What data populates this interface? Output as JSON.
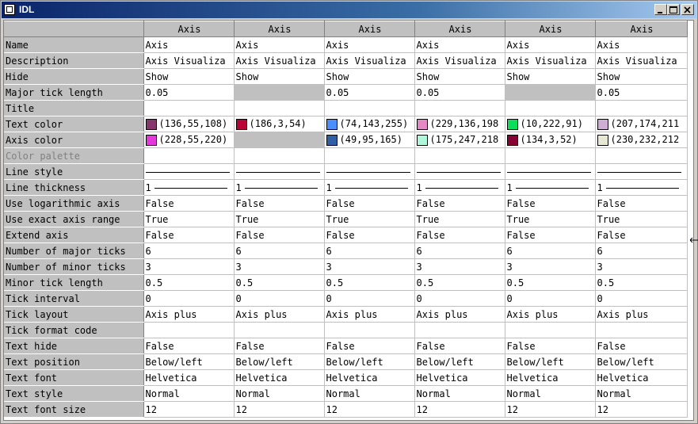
{
  "window": {
    "title": "IDL"
  },
  "columns": [
    "Axis",
    "Axis",
    "Axis",
    "Axis",
    "Axis",
    "Axis"
  ],
  "rows": [
    {
      "label": "Name",
      "values": [
        "Axis",
        "Axis",
        "Axis",
        "Axis",
        "Axis",
        "Axis"
      ]
    },
    {
      "label": "Description",
      "values": [
        "Axis Visualiza",
        "Axis Visualiza",
        "Axis Visualiza",
        "Axis Visualiza",
        "Axis Visualiza",
        "Axis Visualiza"
      ]
    },
    {
      "label": "Hide",
      "values": [
        "Show",
        "Show",
        "Show",
        "Show",
        "Show",
        "Show"
      ]
    },
    {
      "label": "Major tick length",
      "values": [
        "0.05",
        "",
        "0.05",
        "0.05",
        "",
        "0.05"
      ],
      "gray": [
        false,
        true,
        false,
        false,
        true,
        false
      ]
    },
    {
      "label": "Title",
      "values": [
        "",
        "",
        "",
        "",
        "",
        ""
      ]
    },
    {
      "label": "Text color",
      "type": "color",
      "values": [
        "(136,55,108)",
        "(186,3,54)",
        "(74,143,255)",
        "(229,136,198",
        "(10,222,91)",
        "(207,174,211"
      ],
      "colors": [
        "#88376c",
        "#ba0336",
        "#4a8fff",
        "#e588c6",
        "#0ade5b",
        "#cfaed3"
      ]
    },
    {
      "label": "Axis color",
      "type": "color",
      "values": [
        "(228,55,220)",
        "",
        "(49,95,165)",
        "(175,247,218",
        "(134,3,52)",
        "(230,232,212"
      ],
      "colors": [
        "#e437dc",
        "",
        "#315fa5",
        "#aff7da",
        "#860334",
        "#e6e8d4"
      ],
      "gray": [
        false,
        true,
        false,
        false,
        false,
        false
      ]
    },
    {
      "label": "Color palette",
      "disabled": true,
      "values": [
        "",
        "",
        "",
        "",
        "",
        ""
      ]
    },
    {
      "label": "Line style",
      "type": "line",
      "values": [
        "",
        "",
        "",
        "",
        "",
        ""
      ]
    },
    {
      "label": "Line thickness",
      "type": "thick",
      "values": [
        "1",
        "1",
        "1",
        "1",
        "1",
        "1"
      ]
    },
    {
      "label": "Use logarithmic axis",
      "values": [
        "False",
        "False",
        "False",
        "False",
        "False",
        "False"
      ]
    },
    {
      "label": "Use exact axis range",
      "values": [
        "True",
        "True",
        "True",
        "True",
        "True",
        "True"
      ]
    },
    {
      "label": "Extend axis",
      "values": [
        "False",
        "False",
        "False",
        "False",
        "False",
        "False"
      ]
    },
    {
      "label": "Number of major ticks",
      "values": [
        "6",
        "6",
        "6",
        "6",
        "6",
        "6"
      ]
    },
    {
      "label": "Number of minor ticks",
      "values": [
        "3",
        "3",
        "3",
        "3",
        "3",
        "3"
      ]
    },
    {
      "label": "Minor tick length",
      "values": [
        "0.5",
        "0.5",
        "0.5",
        "0.5",
        "0.5",
        "0.5"
      ]
    },
    {
      "label": "Tick interval",
      "values": [
        "0",
        "0",
        "0",
        "0",
        "0",
        "0"
      ]
    },
    {
      "label": "Tick layout",
      "values": [
        "Axis plus",
        "Axis plus",
        "Axis plus",
        "Axis plus",
        "Axis plus",
        "Axis plus"
      ]
    },
    {
      "label": "Tick format code",
      "values": [
        "",
        "",
        "",
        "",
        "",
        ""
      ]
    },
    {
      "label": "Text hide",
      "values": [
        "False",
        "False",
        "False",
        "False",
        "False",
        "False"
      ]
    },
    {
      "label": "Text position",
      "values": [
        "Below/left",
        "Below/left",
        "Below/left",
        "Below/left",
        "Below/left",
        "Below/left"
      ]
    },
    {
      "label": "Text font",
      "values": [
        "Helvetica",
        "Helvetica",
        "Helvetica",
        "Helvetica",
        "Helvetica",
        "Helvetica"
      ]
    },
    {
      "label": "Text style",
      "values": [
        "Normal",
        "Normal",
        "Normal",
        "Normal",
        "Normal",
        "Normal"
      ]
    },
    {
      "label": "Text font size",
      "values": [
        "12",
        "12",
        "12",
        "12",
        "12",
        "12"
      ]
    }
  ]
}
